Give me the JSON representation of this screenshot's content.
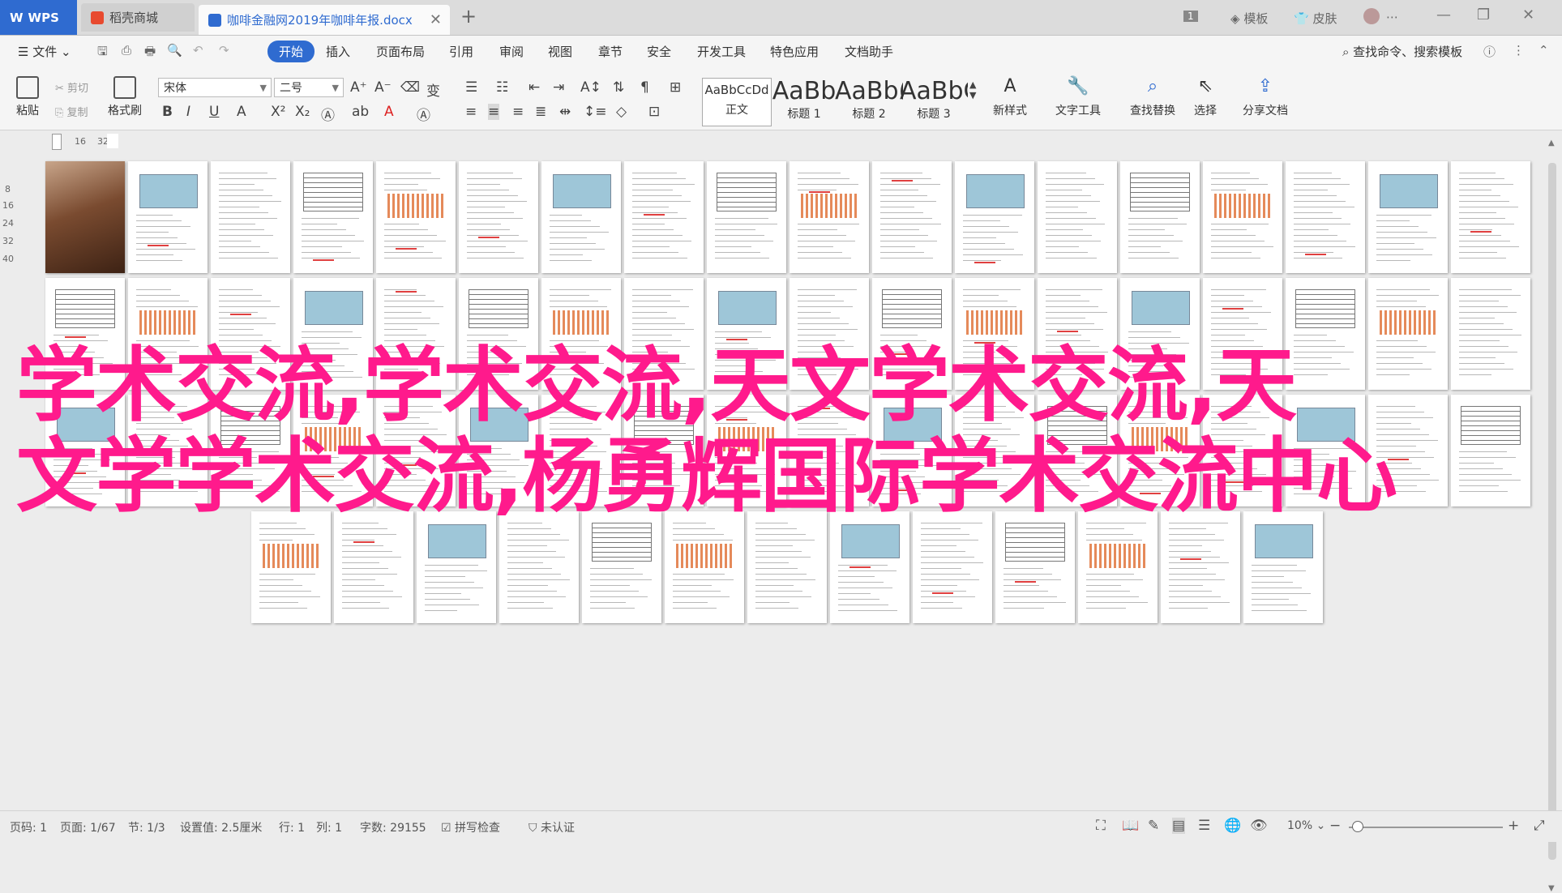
{
  "titlebar": {
    "wps_label": "WPS",
    "store_tab": "稻壳商城",
    "doc_tab": "咖啡金融网2019年咖啡年报.docx",
    "page_badge": "1",
    "template_label": "模板",
    "skin_label": "皮肤"
  },
  "menubar": {
    "file_label": "文件",
    "items": [
      "开始",
      "插入",
      "页面布局",
      "引用",
      "审阅",
      "视图",
      "章节",
      "安全",
      "开发工具",
      "特色应用",
      "文档助手"
    ],
    "search_label": "查找命令、搜索模板"
  },
  "ribbon": {
    "paste": "粘贴",
    "cut": "剪切",
    "copy": "复制",
    "format_painter": "格式刷",
    "font_name": "宋体",
    "font_size": "二号",
    "styles": [
      {
        "sample": "AaBbCcDd",
        "label": "正文"
      },
      {
        "sample": "AaBb",
        "label": "标题 1"
      },
      {
        "sample": "AaBb(",
        "label": "标题 2"
      },
      {
        "sample": "AaBbC",
        "label": "标题 3"
      }
    ],
    "new_style": "新样式",
    "text_tools": "文字工具",
    "find_replace": "查找替换",
    "select": "选择",
    "share_doc": "分享文档"
  },
  "ruler": {
    "h_marks": [
      "16",
      "32"
    ],
    "v_marks": [
      "8",
      "16",
      "24",
      "32",
      "40"
    ]
  },
  "overlay": {
    "line1": "学术交流,学术交流,天文学术交流,天",
    "line2": "文学学术交流,杨勇辉国际学术交流中心"
  },
  "statusbar": {
    "page_code": "页码: 1",
    "page": "页面: 1/67",
    "section": "节: 1/3",
    "position": "设置值: 2.5厘米",
    "row": "行: 1",
    "col": "列: 1",
    "word_count": "字数: 29155",
    "spell_check": "拼写检查",
    "certify": "未认证",
    "zoom": "10%"
  },
  "colors": {
    "accent": "#2f6bd0",
    "overlay": "#ff1a8c"
  }
}
